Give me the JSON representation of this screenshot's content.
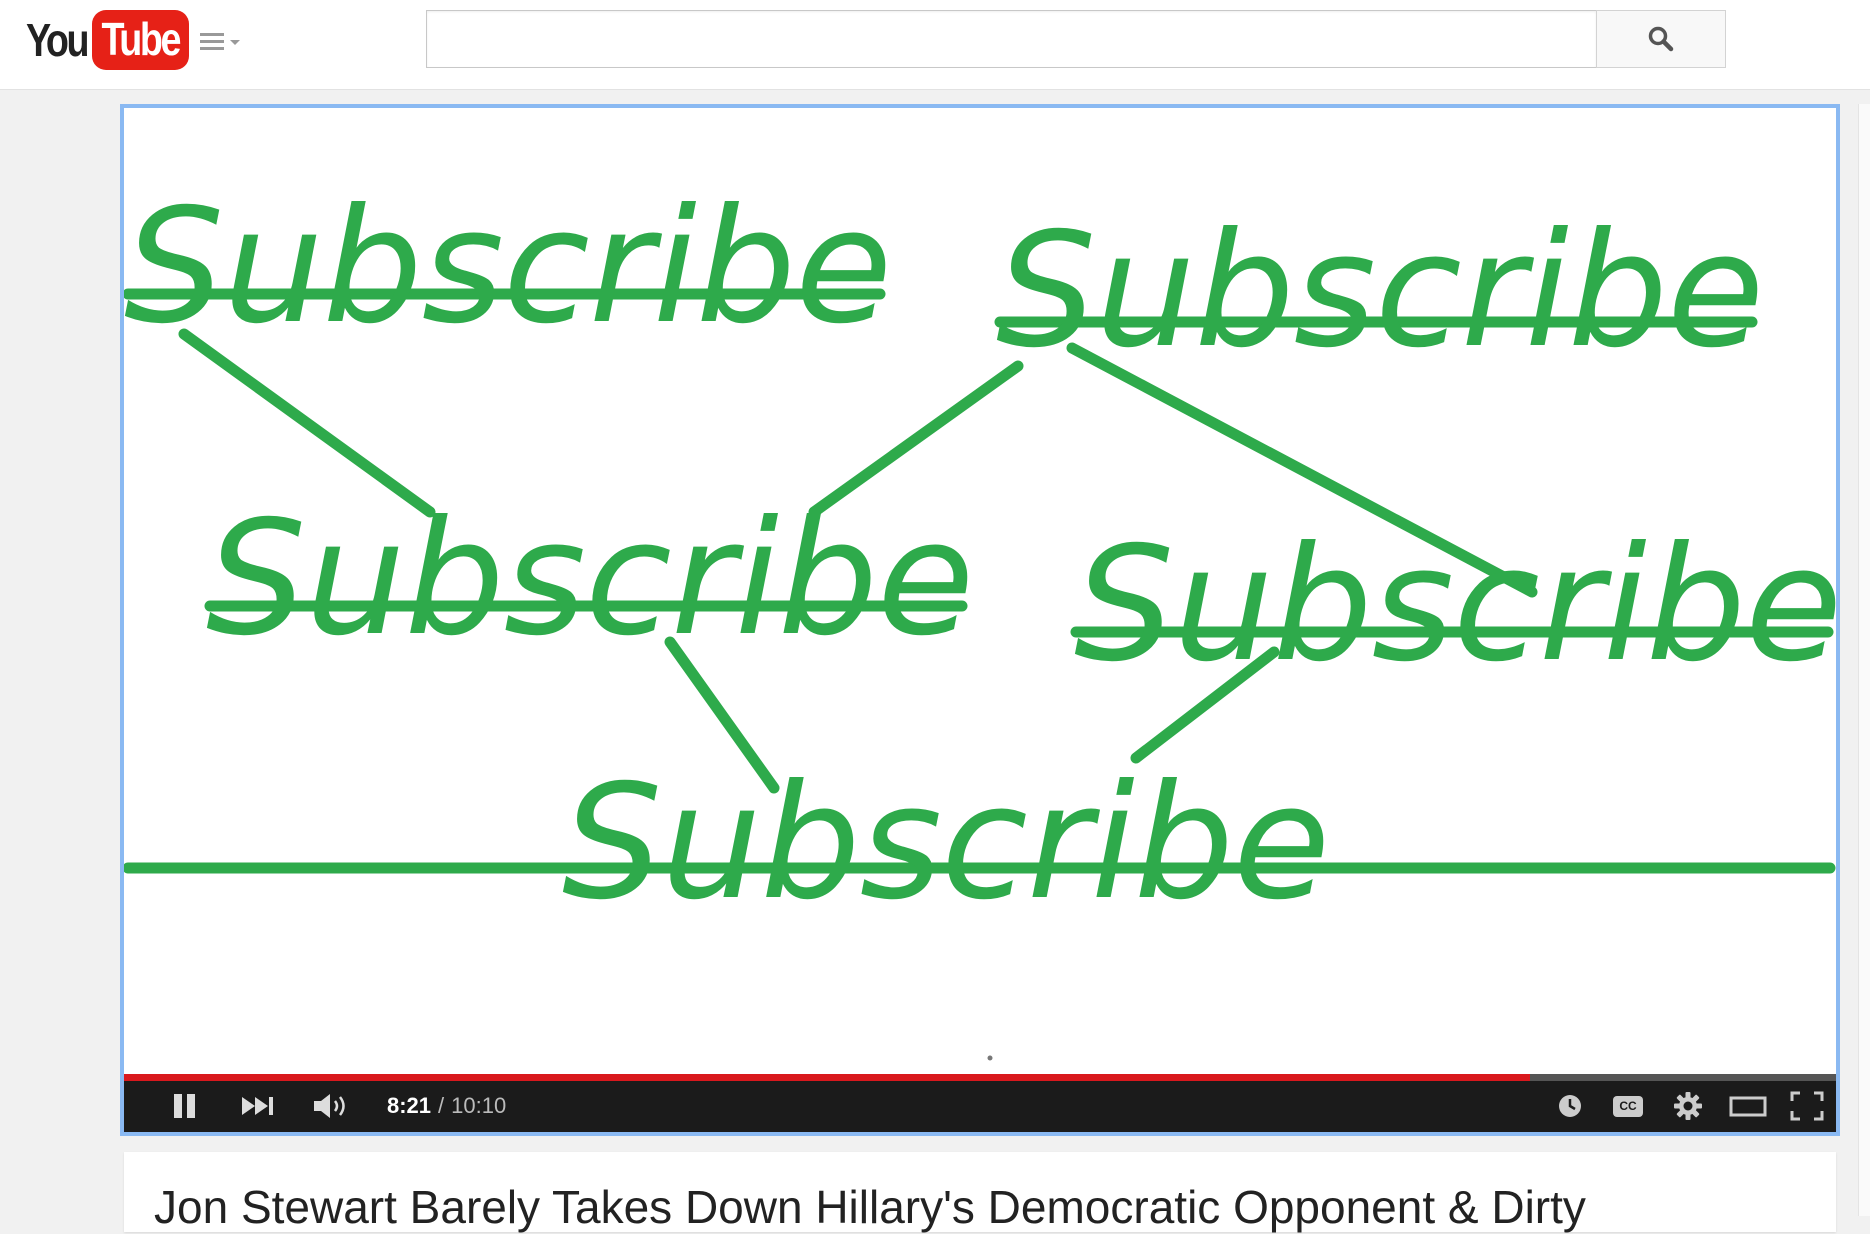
{
  "logo": {
    "part1": "You",
    "part2": "Tube"
  },
  "search": {
    "value": "",
    "placeholder": ""
  },
  "video": {
    "overlay_words": [
      "Subscribe",
      "Subscribe",
      "Subscribe",
      "Subscribe",
      "Subscribe"
    ],
    "accent_color": "#2eaa4b",
    "background_color": "#ffffff"
  },
  "player": {
    "current_time": "8:21",
    "separator": "/",
    "duration": "10:10",
    "progress_fraction": 0.821,
    "progress_color": "#d9181d",
    "icons": [
      "pause-icon",
      "next-icon",
      "volume-icon",
      "watch-later-icon",
      "captions-icon",
      "settings-icon",
      "theater-mode-icon",
      "fullscreen-icon"
    ],
    "captions_label": "CC"
  },
  "title": "Jon Stewart Barely Takes Down Hillary's Democratic Opponent & Dirty"
}
